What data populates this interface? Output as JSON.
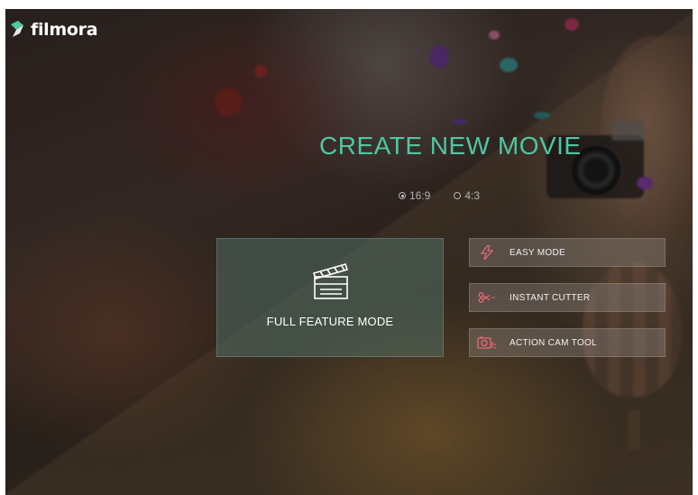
{
  "app": {
    "logo_text": "filmora",
    "brand_color": "#4fc6a4"
  },
  "heading": {
    "title": "CREATE NEW MOVIE"
  },
  "aspect_ratios": [
    {
      "label": "16:9",
      "selected": true
    },
    {
      "label": "4:3",
      "selected": false
    }
  ],
  "modes": {
    "full_feature": {
      "label": "FULL FEATURE MODE",
      "icon": "clapperboard-icon"
    },
    "easy": {
      "label": "EASY MODE",
      "icon": "lightning-icon"
    },
    "cutter": {
      "label": "INSTANT CUTTER",
      "icon": "scissors-icon"
    },
    "action_cam": {
      "label": "ACTION CAM TOOL",
      "icon": "action-camera-icon"
    }
  }
}
